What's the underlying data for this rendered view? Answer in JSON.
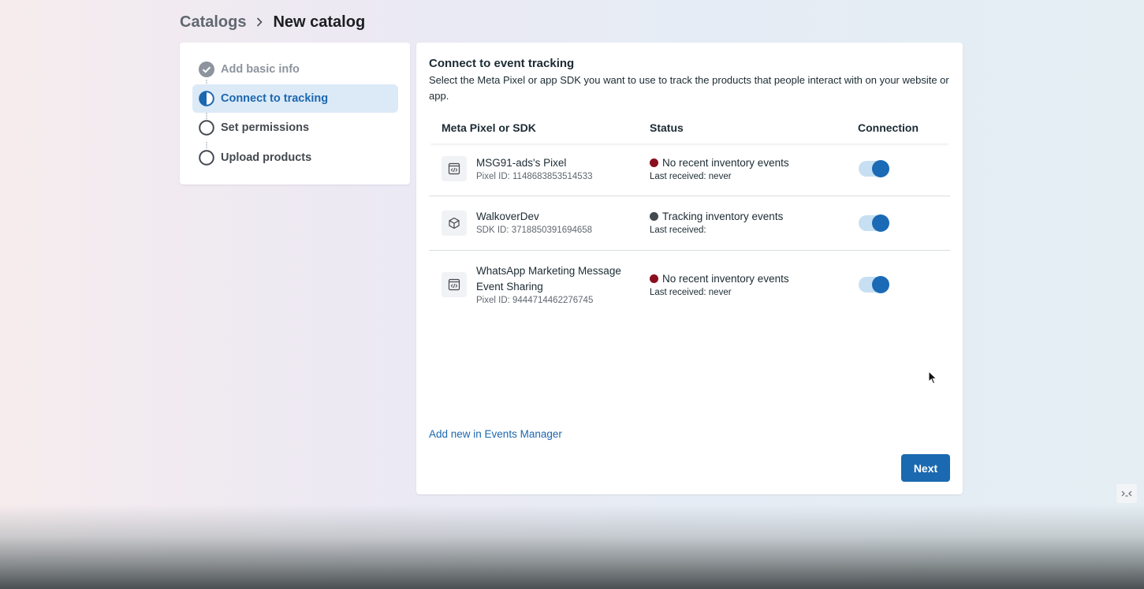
{
  "breadcrumb": {
    "parent": "Catalogs",
    "current": "New catalog"
  },
  "steps": [
    {
      "label": "Add basic info",
      "state": "done"
    },
    {
      "label": "Connect to tracking",
      "state": "active"
    },
    {
      "label": "Set permissions",
      "state": "pending"
    },
    {
      "label": "Upload products",
      "state": "pending"
    }
  ],
  "main": {
    "title": "Connect to event tracking",
    "description": "Select the Meta Pixel or app SDK you want to use to track the products that people interact with on your website or app.",
    "columns": {
      "name": "Meta Pixel or SDK",
      "status": "Status",
      "connection": "Connection"
    },
    "rows": [
      {
        "name": "MSG91-ads's Pixel",
        "id": "Pixel ID: 1148683853514533",
        "icon": "code-window-icon",
        "status": "No recent inventory events",
        "status_color": "#8a0f1e",
        "last_received": "Last received: never",
        "connected": true
      },
      {
        "name": "WalkoverDev",
        "id": "SDK ID: 3718850391694658",
        "icon": "cube-icon",
        "status": "Tracking inventory events",
        "status_color": "#444950",
        "last_received": "Last received:",
        "connected": true
      },
      {
        "name": "WhatsApp Marketing Message Event Sharing",
        "id": "Pixel ID: 9444714462276745",
        "icon": "code-window-icon",
        "status": "No recent inventory events",
        "status_color": "#8a0f1e",
        "last_received": "Last received: never",
        "connected": true
      }
    ],
    "add_link": "Add new in Events Manager",
    "next_button": "Next"
  },
  "colors": {
    "accent": "#1b69b0",
    "active_step_bg": "#dceaf7",
    "toggle_track": "#c6dff2"
  }
}
